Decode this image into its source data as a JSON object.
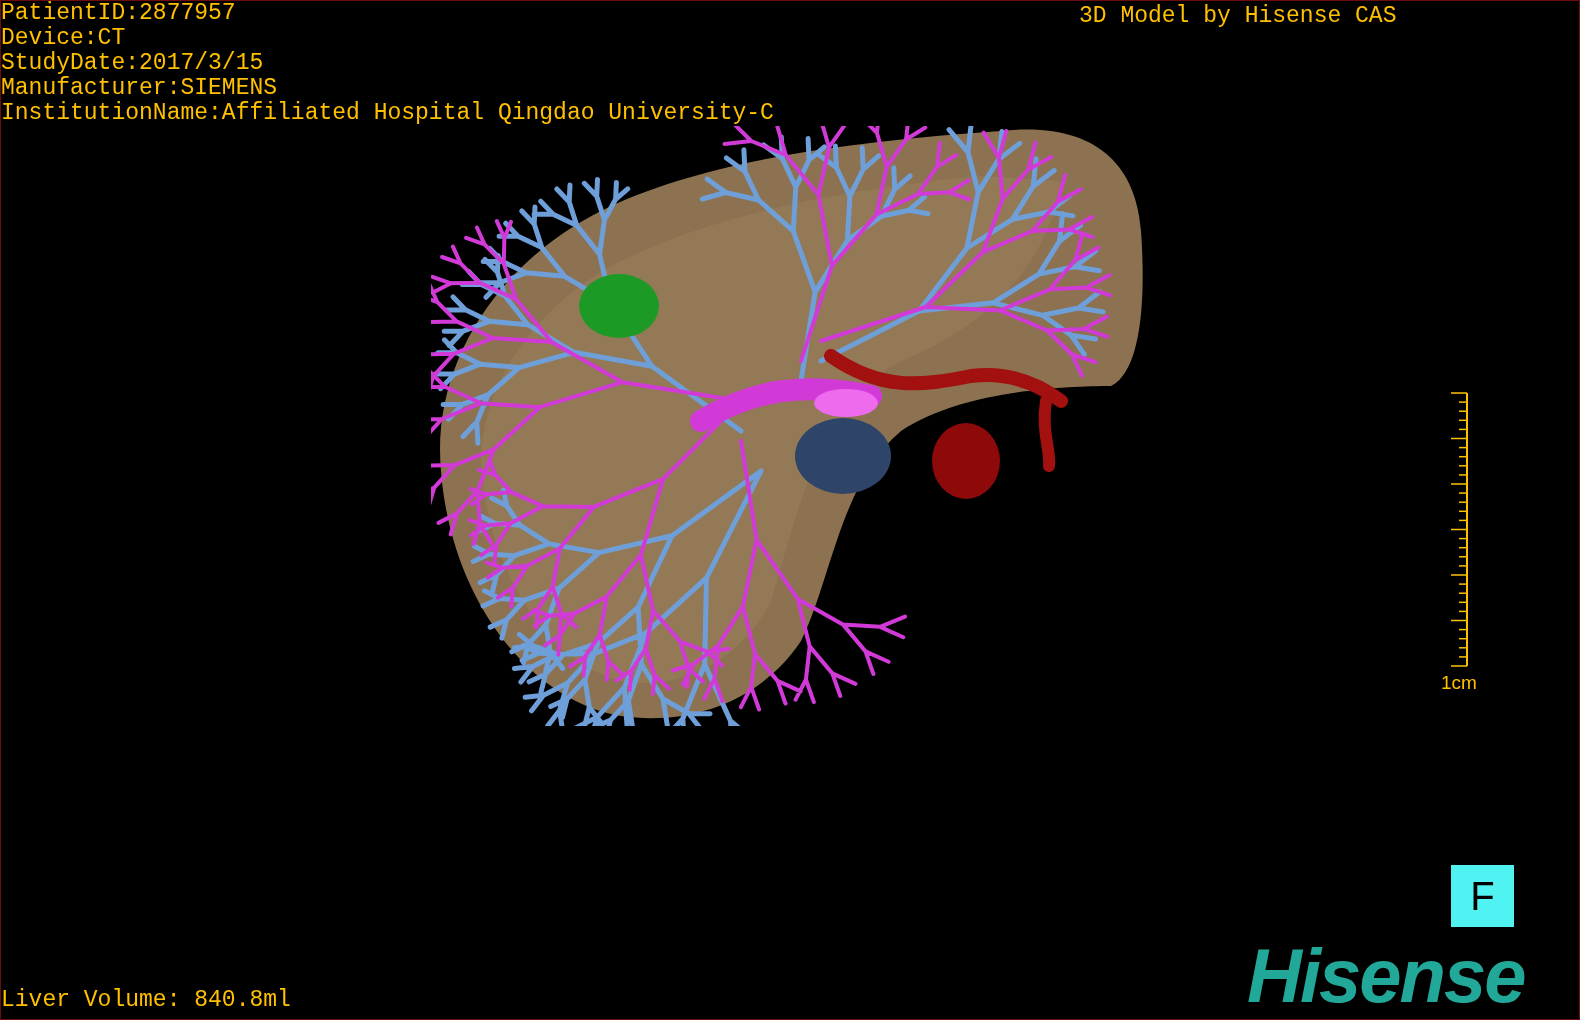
{
  "info_lines": [
    "PatientID:2877957",
    "Device:CT",
    "StudyDate:2017/3/15",
    "Manufacturer:SIEMENS",
    "InstitutionName:Affiliated Hospital Qingdao University-C"
  ],
  "model_caption": "3D Model by Hisense CAS",
  "scale_bar": {
    "label": "1cm"
  },
  "orientation_button": "F",
  "logo": "Hisense",
  "liver_volume": "Liver Volume: 840.8ml"
}
